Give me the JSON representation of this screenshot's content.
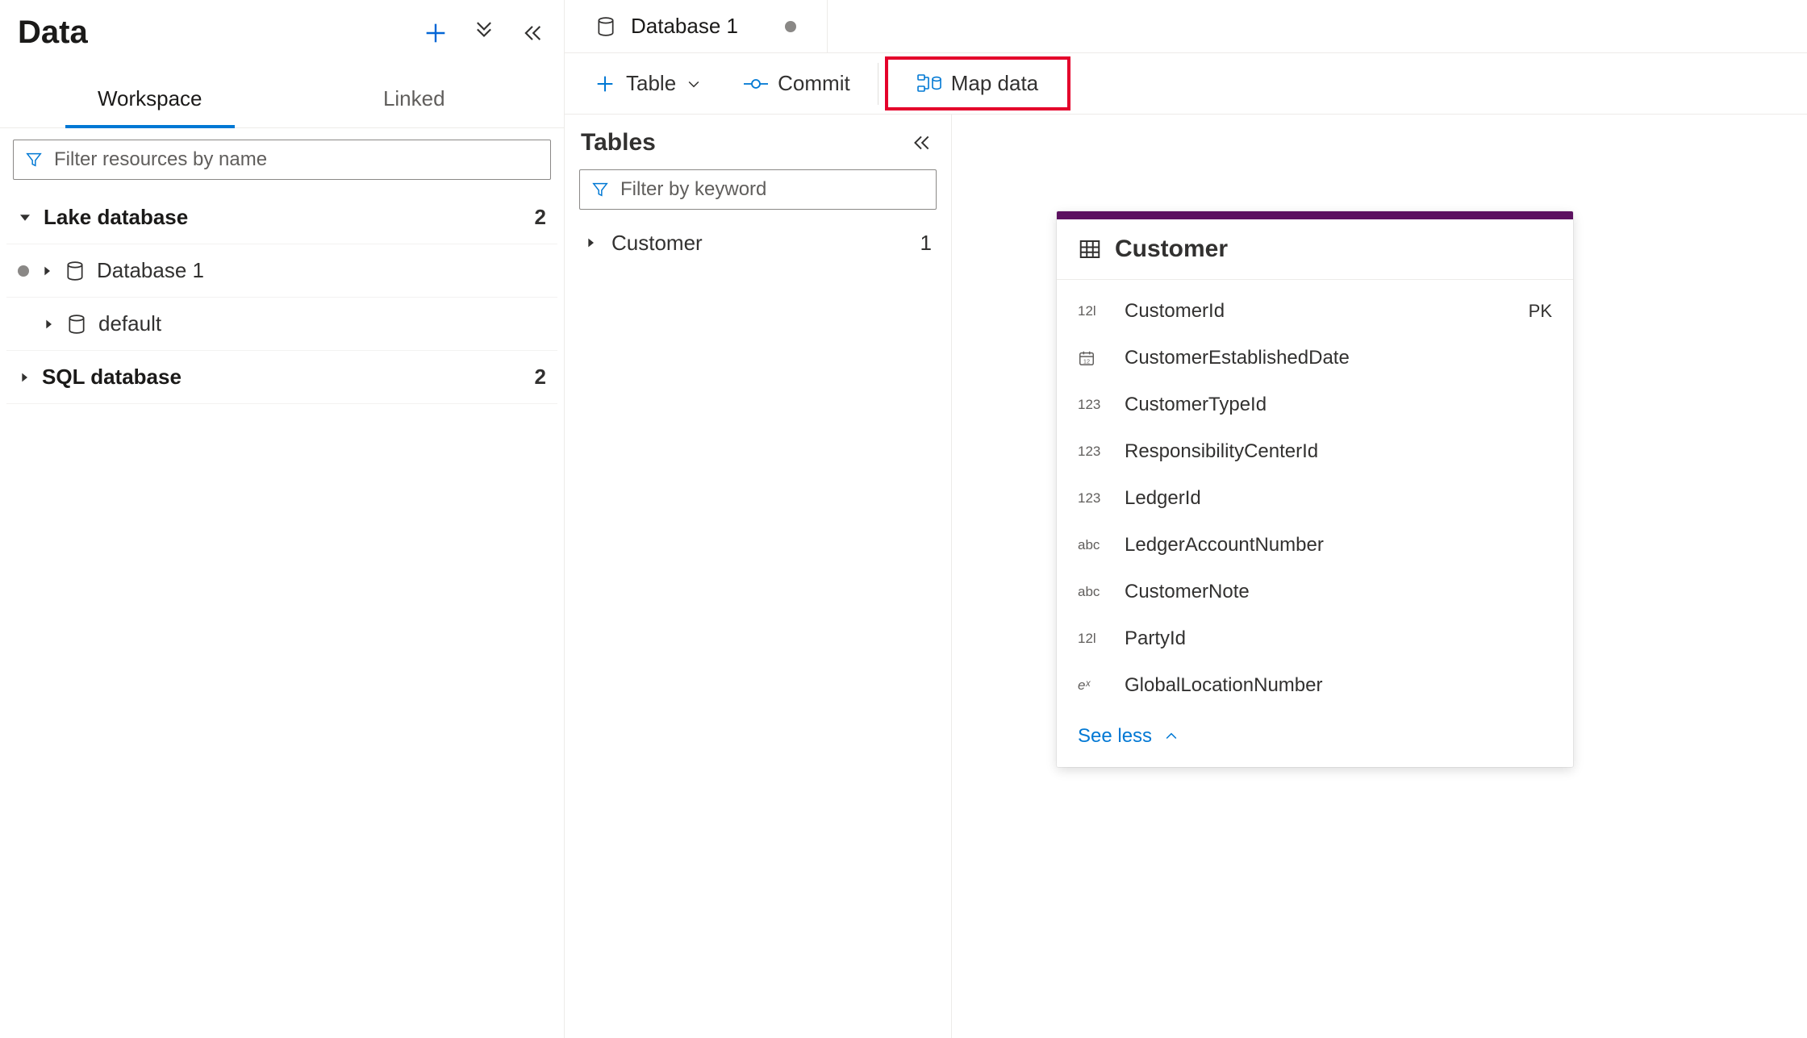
{
  "sidebar": {
    "title": "Data",
    "tabs": {
      "workspace": "Workspace",
      "linked": "Linked"
    },
    "filter_placeholder": "Filter resources by name",
    "groups": [
      {
        "label": "Lake database",
        "count": "2",
        "expanded": true,
        "children": [
          {
            "label": "Database 1",
            "dirty": true
          },
          {
            "label": "default",
            "dirty": false
          }
        ]
      },
      {
        "label": "SQL database",
        "count": "2",
        "expanded": false,
        "children": []
      }
    ]
  },
  "main": {
    "tab": {
      "label": "Database 1"
    },
    "toolbar": {
      "table_label": "Table",
      "commit_label": "Commit",
      "mapdata_label": "Map data"
    },
    "tables_panel": {
      "title": "Tables",
      "filter_placeholder": "Filter by keyword",
      "rows": [
        {
          "label": "Customer",
          "count": "1"
        }
      ]
    },
    "entity": {
      "name": "Customer",
      "fields": [
        {
          "type": "12l",
          "type_style": "plain",
          "name": "CustomerId",
          "key": "PK"
        },
        {
          "type": "cal",
          "type_style": "icon",
          "name": "CustomerEstablishedDate",
          "key": ""
        },
        {
          "type": "123",
          "type_style": "plain",
          "name": "CustomerTypeId",
          "key": ""
        },
        {
          "type": "123",
          "type_style": "plain",
          "name": "ResponsibilityCenterId",
          "key": ""
        },
        {
          "type": "123",
          "type_style": "plain",
          "name": "LedgerId",
          "key": ""
        },
        {
          "type": "abc",
          "type_style": "plain",
          "name": "LedgerAccountNumber",
          "key": ""
        },
        {
          "type": "abc",
          "type_style": "plain",
          "name": "CustomerNote",
          "key": ""
        },
        {
          "type": "12l",
          "type_style": "plain",
          "name": "PartyId",
          "key": ""
        },
        {
          "type": "eˣ",
          "type_style": "italic",
          "name": "GlobalLocationNumber",
          "key": ""
        }
      ],
      "see_less": "See less"
    }
  }
}
